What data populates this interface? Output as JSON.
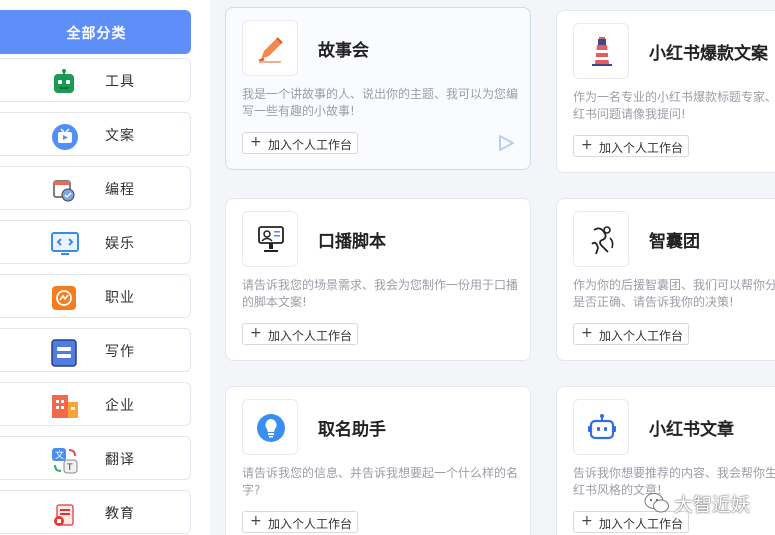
{
  "sidebar": {
    "categories": [
      {
        "label": "全部分类",
        "icon": "all-categories",
        "active": true
      },
      {
        "label": "工具",
        "icon": "robot-icon"
      },
      {
        "label": "文案",
        "icon": "tv-icon"
      },
      {
        "label": "编程",
        "icon": "coding-icon"
      },
      {
        "label": "娱乐",
        "icon": "monitor-code-icon"
      },
      {
        "label": "职业",
        "icon": "chart-icon"
      },
      {
        "label": "写作",
        "icon": "document-icon"
      },
      {
        "label": "企业",
        "icon": "building-icon"
      },
      {
        "label": "翻译",
        "icon": "translate-icon"
      },
      {
        "label": "教育",
        "icon": "education-icon"
      }
    ]
  },
  "cards": [
    {
      "title": "故事会",
      "desc": "我是一个讲故事的人、说出你的主题、我可以为您编写一些有趣的小故事!",
      "add": "加入个人工作台",
      "icon": "pencil-icon"
    },
    {
      "title": "小红书爆款文案",
      "desc": "作为一名专业的小红书爆款标题专家、",
      "desc2": "红书问题请像我提问!",
      "add": "加入个人工作台",
      "icon": "lighthouse-icon"
    },
    {
      "title": "口播脚本",
      "desc": "请告诉我您的场景需求、我会为您制作一份用于口播的脚本文案!",
      "add": "加入个人工作台",
      "icon": "presenter-icon"
    },
    {
      "title": "智囊团",
      "desc": "作为你的后援智囊团、我们可以帮你分",
      "desc2": "是否正确、请告诉我你的决策!",
      "add": "加入个人工作台",
      "icon": "thinker-icon"
    },
    {
      "title": "取名助手",
      "desc": "请告诉我您的信息、并告诉我想要起一个什么样的名字?",
      "add": "加入个人工作台",
      "icon": "lightbulb-icon"
    },
    {
      "title": "小红书文章",
      "desc": "告诉我你想要推荐的内容、我会帮你生",
      "desc2": "红书风格的文章!",
      "add": "加入个人工作台",
      "icon": "robot-head-icon"
    }
  ],
  "watermark": {
    "text": "大智近妖"
  },
  "colors": {
    "accent": "#5e8ef7",
    "active_text": "#ffffff"
  }
}
